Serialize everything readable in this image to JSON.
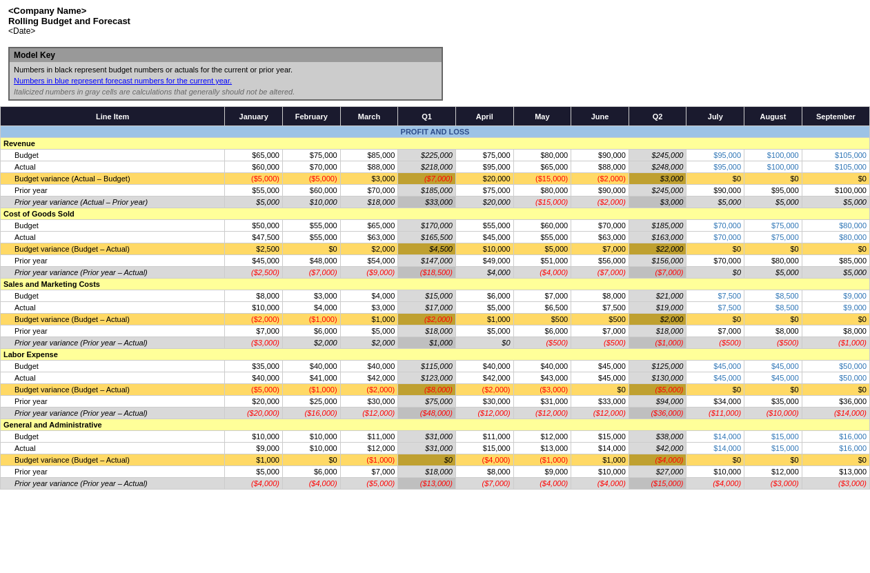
{
  "header": {
    "company": "<Company Name>",
    "title": "Rolling Budget and Forecast",
    "date": "<Date>"
  },
  "modelKey": {
    "header": "Model Key",
    "line1": "Numbers in black represent budget numbers or actuals for the current or prior year.",
    "line2": "Numbers in blue represent forecast numbers for the current year.",
    "line3": "Italicized numbers in gray cells are calculations that generally should not be altered."
  },
  "columns": [
    "Line Item",
    "January",
    "February",
    "March",
    "Q1",
    "April",
    "May",
    "June",
    "Q2",
    "July",
    "August",
    "September"
  ],
  "sections": [
    {
      "name": "PROFIT AND LOSS",
      "groups": [
        {
          "category": "Revenue",
          "rows": [
            {
              "label": "Budget",
              "vals": [
                "$65,000",
                "$75,000",
                "$85,000",
                "$225,000",
                "$75,000",
                "$80,000",
                "$90,000",
                "$245,000",
                "$95,000",
                "$100,000",
                "$105,000"
              ],
              "type": "budget"
            },
            {
              "label": "Actual",
              "vals": [
                "$60,000",
                "$70,000",
                "$88,000",
                "$218,000",
                "$95,000",
                "$65,000",
                "$88,000",
                "$248,000",
                "$95,000",
                "$100,000",
                "$105,000"
              ],
              "type": "actual"
            },
            {
              "label": "Budget variance (Actual – Budget)",
              "vals": [
                "($5,000)",
                "($5,000)",
                "$3,000",
                "($7,000)",
                "$20,000",
                "($15,000)",
                "($2,000)",
                "$3,000",
                "$0",
                "$0",
                "$0"
              ],
              "type": "bv",
              "colors": [
                "red",
                "red",
                "black",
                "red",
                "black",
                "red",
                "red",
                "black",
                "black",
                "black",
                "black"
              ]
            },
            {
              "label": "Prior year",
              "vals": [
                "$55,000",
                "$60,000",
                "$70,000",
                "$185,000",
                "$75,000",
                "$80,000",
                "$90,000",
                "$245,000",
                "$90,000",
                "$95,000",
                "$100,000"
              ],
              "type": "py"
            },
            {
              "label": "Prior year variance (Actual – Prior year)",
              "vals": [
                "$5,000",
                "$10,000",
                "$18,000",
                "$33,000",
                "$20,000",
                "($15,000)",
                "($2,000)",
                "$3,000",
                "$5,000",
                "$5,000",
                "$5,000"
              ],
              "type": "pyv",
              "colors": [
                "black",
                "black",
                "black",
                "black",
                "black",
                "red",
                "red",
                "black",
                "black",
                "black",
                "black"
              ]
            }
          ]
        },
        {
          "category": "Cost of Goods Sold",
          "rows": [
            {
              "label": "Budget",
              "vals": [
                "$50,000",
                "$55,000",
                "$65,000",
                "$170,000",
                "$55,000",
                "$60,000",
                "$70,000",
                "$185,000",
                "$70,000",
                "$75,000",
                "$80,000"
              ],
              "type": "budget"
            },
            {
              "label": "Actual",
              "vals": [
                "$47,500",
                "$55,000",
                "$63,000",
                "$165,500",
                "$45,000",
                "$55,000",
                "$63,000",
                "$163,000",
                "$70,000",
                "$75,000",
                "$80,000"
              ],
              "type": "actual"
            },
            {
              "label": "Budget variance (Budget – Actual)",
              "vals": [
                "$2,500",
                "$0",
                "$2,000",
                "$4,500",
                "$10,000",
                "$5,000",
                "$7,000",
                "$22,000",
                "$0",
                "$0",
                "$0"
              ],
              "type": "bv",
              "colors": [
                "black",
                "black",
                "black",
                "black",
                "black",
                "black",
                "black",
                "black",
                "black",
                "black",
                "black"
              ]
            },
            {
              "label": "Prior year",
              "vals": [
                "$45,000",
                "$48,000",
                "$54,000",
                "$147,000",
                "$49,000",
                "$51,000",
                "$56,000",
                "$156,000",
                "$70,000",
                "$80,000",
                "$85,000"
              ],
              "type": "py"
            },
            {
              "label": "Prior year variance (Prior year – Actual)",
              "vals": [
                "($2,500)",
                "($7,000)",
                "($9,000)",
                "($18,500)",
                "$4,000",
                "($4,000)",
                "($7,000)",
                "($7,000)",
                "$0",
                "$5,000",
                "$5,000"
              ],
              "type": "pyv",
              "colors": [
                "red",
                "red",
                "red",
                "red",
                "black",
                "red",
                "red",
                "red",
                "black",
                "black",
                "black"
              ]
            }
          ]
        },
        {
          "category": "Sales and Marketing Costs",
          "rows": [
            {
              "label": "Budget",
              "vals": [
                "$8,000",
                "$3,000",
                "$4,000",
                "$15,000",
                "$6,000",
                "$7,000",
                "$8,000",
                "$21,000",
                "$7,500",
                "$8,500",
                "$9,000"
              ],
              "type": "budget"
            },
            {
              "label": "Actual",
              "vals": [
                "$10,000",
                "$4,000",
                "$3,000",
                "$17,000",
                "$5,000",
                "$6,500",
                "$7,500",
                "$19,000",
                "$7,500",
                "$8,500",
                "$9,000"
              ],
              "type": "actual"
            },
            {
              "label": "Budget variance (Budget – Actual)",
              "vals": [
                "($2,000)",
                "($1,000)",
                "$1,000",
                "($2,000)",
                "$1,000",
                "$500",
                "$500",
                "$2,000",
                "$0",
                "$0",
                "$0"
              ],
              "type": "bv",
              "colors": [
                "red",
                "red",
                "black",
                "red",
                "black",
                "black",
                "black",
                "black",
                "black",
                "black",
                "black"
              ]
            },
            {
              "label": "Prior year",
              "vals": [
                "$7,000",
                "$6,000",
                "$5,000",
                "$18,000",
                "$5,000",
                "$6,000",
                "$7,000",
                "$18,000",
                "$7,000",
                "$8,000",
                "$8,000"
              ],
              "type": "py"
            },
            {
              "label": "Prior year variance (Prior year – Actual)",
              "vals": [
                "($3,000)",
                "$2,000",
                "$2,000",
                "$1,000",
                "$0",
                "($500)",
                "($500)",
                "($1,000)",
                "($500)",
                "($500)",
                "($1,000)"
              ],
              "type": "pyv",
              "colors": [
                "red",
                "black",
                "black",
                "black",
                "black",
                "red",
                "red",
                "red",
                "red",
                "red",
                "red"
              ]
            }
          ]
        },
        {
          "category": "Labor Expense",
          "rows": [
            {
              "label": "Budget",
              "vals": [
                "$35,000",
                "$40,000",
                "$40,000",
                "$115,000",
                "$40,000",
                "$40,000",
                "$45,000",
                "$125,000",
                "$45,000",
                "$45,000",
                "$50,000"
              ],
              "type": "budget"
            },
            {
              "label": "Actual",
              "vals": [
                "$40,000",
                "$41,000",
                "$42,000",
                "$123,000",
                "$42,000",
                "$43,000",
                "$45,000",
                "$130,000",
                "$45,000",
                "$45,000",
                "$50,000"
              ],
              "type": "actual"
            },
            {
              "label": "Budget variance (Budget – Actual)",
              "vals": [
                "($5,000)",
                "($1,000)",
                "($2,000)",
                "($8,000)",
                "($2,000)",
                "($3,000)",
                "$0",
                "($5,000)",
                "$0",
                "$0",
                "$0"
              ],
              "type": "bv",
              "colors": [
                "red",
                "red",
                "red",
                "red",
                "red",
                "red",
                "black",
                "red",
                "black",
                "black",
                "black"
              ]
            },
            {
              "label": "Prior year",
              "vals": [
                "$20,000",
                "$25,000",
                "$30,000",
                "$75,000",
                "$30,000",
                "$31,000",
                "$33,000",
                "$94,000",
                "$34,000",
                "$35,000",
                "$36,000"
              ],
              "type": "py"
            },
            {
              "label": "Prior year variance (Prior year – Actual)",
              "vals": [
                "($20,000)",
                "($16,000)",
                "($12,000)",
                "($48,000)",
                "($12,000)",
                "($12,000)",
                "($12,000)",
                "($36,000)",
                "($11,000)",
                "($10,000)",
                "($14,000)"
              ],
              "type": "pyv",
              "colors": [
                "red",
                "red",
                "red",
                "red",
                "red",
                "red",
                "red",
                "red",
                "red",
                "red",
                "red"
              ]
            }
          ]
        },
        {
          "category": "General and Administrative",
          "rows": [
            {
              "label": "Budget",
              "vals": [
                "$10,000",
                "$10,000",
                "$11,000",
                "$31,000",
                "$11,000",
                "$12,000",
                "$15,000",
                "$38,000",
                "$14,000",
                "$15,000",
                "$16,000"
              ],
              "type": "budget"
            },
            {
              "label": "Actual",
              "vals": [
                "$9,000",
                "$10,000",
                "$12,000",
                "$31,000",
                "$15,000",
                "$13,000",
                "$14,000",
                "$42,000",
                "$14,000",
                "$15,000",
                "$16,000"
              ],
              "type": "actual"
            },
            {
              "label": "Budget variance (Budget – Actual)",
              "vals": [
                "$1,000",
                "$0",
                "($1,000)",
                "$0",
                "($4,000)",
                "($1,000)",
                "$1,000",
                "($4,000)",
                "$0",
                "$0",
                "$0"
              ],
              "type": "bv",
              "colors": [
                "black",
                "black",
                "red",
                "black",
                "red",
                "red",
                "black",
                "red",
                "black",
                "black",
                "black"
              ]
            },
            {
              "label": "Prior year",
              "vals": [
                "$5,000",
                "$6,000",
                "$7,000",
                "$18,000",
                "$8,000",
                "$9,000",
                "$10,000",
                "$27,000",
                "$10,000",
                "$12,000",
                "$13,000"
              ],
              "type": "py"
            },
            {
              "label": "Prior year variance (Prior year – Actual)",
              "vals": [
                "($4,000)",
                "($4,000)",
                "($5,000)",
                "($13,000)",
                "($7,000)",
                "($4,000)",
                "($4,000)",
                "($15,000)",
                "($4,000)",
                "($3,000)",
                "($3,000)"
              ],
              "type": "pyv",
              "colors": [
                "red",
                "red",
                "red",
                "red",
                "red",
                "red",
                "red",
                "red",
                "red",
                "red",
                "red"
              ]
            }
          ]
        }
      ]
    }
  ]
}
